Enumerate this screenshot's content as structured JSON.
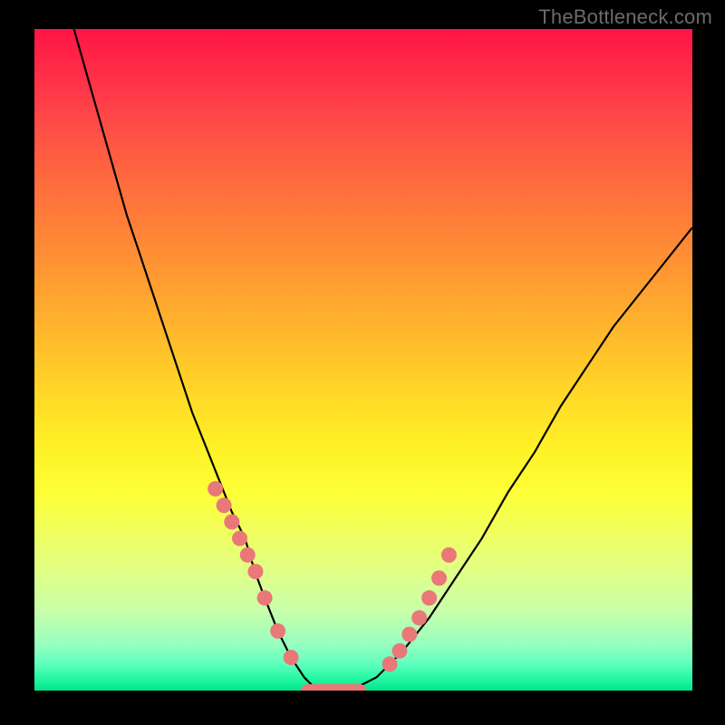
{
  "watermark": "TheBottleneck.com",
  "colors": {
    "dot": "#e97878",
    "curve": "#000000"
  },
  "chart_data": {
    "type": "line",
    "title": "",
    "xlabel": "",
    "ylabel": "",
    "xlim": [
      0,
      100
    ],
    "ylim": [
      0,
      100
    ],
    "grid": false,
    "legend": false,
    "series": [
      {
        "name": "bottleneck-curve",
        "x": [
          6,
          8,
          10,
          12,
          14,
          16,
          18,
          20,
          22,
          24,
          26,
          28,
          30,
          32,
          33.5,
          35,
          37,
          39,
          41,
          43,
          45,
          48,
          52,
          56,
          60,
          64,
          68,
          72,
          76,
          80,
          84,
          88,
          92,
          96,
          100
        ],
        "y": [
          100,
          93,
          86,
          79,
          72,
          66,
          60,
          54,
          48,
          42,
          37,
          32,
          27,
          23,
          18,
          14,
          9,
          5,
          2,
          0,
          0,
          0,
          2,
          6,
          11,
          17,
          23,
          30,
          36,
          43,
          49,
          55,
          60,
          65,
          70
        ]
      }
    ],
    "markers": {
      "name": "highlight-dots",
      "x": [
        27.5,
        28.8,
        30.0,
        31.2,
        32.4,
        33.6,
        35.0,
        37.0,
        39.0,
        54.0,
        55.5,
        57.0,
        58.5,
        60.0,
        61.5,
        63.0
      ],
      "y": [
        30.5,
        28.0,
        25.5,
        23.0,
        20.5,
        18.0,
        14.0,
        9.0,
        5.0,
        4.0,
        6.0,
        8.5,
        11.0,
        14.0,
        17.0,
        20.5
      ]
    },
    "plateau": {
      "name": "zero-band",
      "x": [
        41.5,
        49.5
      ],
      "y": 0
    }
  }
}
